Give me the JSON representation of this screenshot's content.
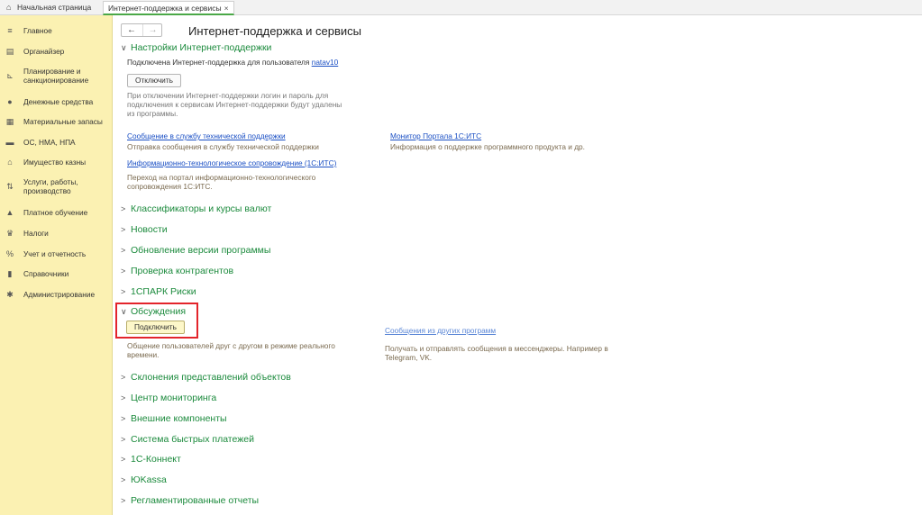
{
  "tabs": {
    "home": "Начальная страница",
    "active": "Интернет-поддержка и сервисы",
    "close_icon": "×"
  },
  "sidebar": {
    "items": [
      {
        "icon": "menu-icon",
        "glyph": "≡",
        "label": "Главное"
      },
      {
        "icon": "calendar-icon",
        "glyph": "▤",
        "label": "Органайзер"
      },
      {
        "icon": "chart-icon",
        "glyph": "⊾",
        "label": "Планирование и санкционирование"
      },
      {
        "icon": "coin-icon",
        "glyph": "●",
        "label": "Денежные средства"
      },
      {
        "icon": "boxes-icon",
        "glyph": "▦",
        "label": "Материальные запасы"
      },
      {
        "icon": "truck-icon",
        "glyph": "▬",
        "label": "ОС, НМА, НПА"
      },
      {
        "icon": "building-icon",
        "glyph": "⌂",
        "label": "Имущество казны"
      },
      {
        "icon": "services-icon",
        "glyph": "⇅",
        "label": "Услуги, работы, производство"
      },
      {
        "icon": "graduation-icon",
        "glyph": "▲",
        "label": "Платное обучение"
      },
      {
        "icon": "emblem-icon",
        "glyph": "♛",
        "label": "Налоги"
      },
      {
        "icon": "accounting-icon",
        "glyph": "%",
        "label": "Учет и отчетность"
      },
      {
        "icon": "book-icon",
        "glyph": "▮",
        "label": "Справочники"
      },
      {
        "icon": "gear-icon",
        "glyph": "✱",
        "label": "Администрирование"
      }
    ]
  },
  "main": {
    "back": "←",
    "forward": "→",
    "title": "Интернет-поддержка и сервисы",
    "settings": {
      "heading": "Настройки Интернет-поддержки",
      "connected_text": "Подключена Интернет-поддержка для пользователя",
      "user": "natav10",
      "disconnect_btn": "Отключить",
      "disconnect_note": "При отключении Интернет-поддержки логин и пароль для подключения к сервисам Интернет-поддержки будут удалены из программы.",
      "support_link": "Сообщение в службу технической поддержки",
      "support_desc": "Отправка сообщения в службу технической поддержки",
      "its_link": "Информационно-технологическое сопровождение (1С:ИТС)",
      "its_desc": "Переход на портал информационно-технологического сопровождения 1С:ИТС.",
      "monitor_link": "Монитор Портала 1С:ИТС",
      "monitor_desc": "Информация о поддержке программного продукта и др."
    },
    "sections_before": [
      "Классификаторы и курсы валют",
      "Новости",
      "Обновление версии программы",
      "Проверка контрагентов",
      "1СПАРК Риски"
    ],
    "discussions": {
      "heading": "Обсуждения",
      "connect_btn": "Подключить",
      "desc": "Общение пользователей друг с другом в режиме реального времени.",
      "other_link": "Сообщения из других программ",
      "other_desc": "Получать и отправлять сообщения в мессенджеры. Например в Telegram, VK."
    },
    "sections_after": [
      "Склонения представлений объектов",
      "Центр мониторинга",
      "Внешние компоненты",
      "Система быстрых платежей",
      "1С-Коннект",
      "ЮKassa",
      "Регламентированные отчеты"
    ],
    "chevron_collapsed": ">",
    "chevron_expanded": "∨"
  }
}
